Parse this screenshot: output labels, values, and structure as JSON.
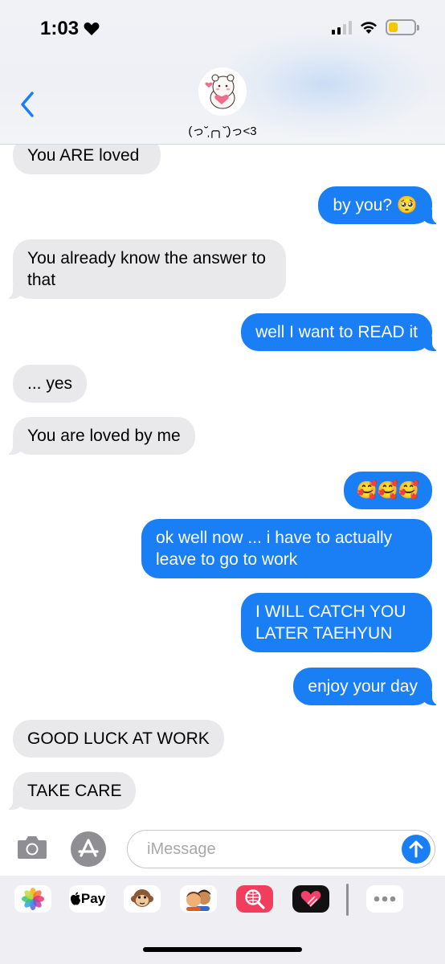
{
  "status_bar": {
    "time": "1:03",
    "battery_level": 0.38,
    "battery_color": "#f7c600"
  },
  "header": {
    "contact_name": "(っ˘̩╭╮˘̩)っ<3",
    "avatar_icon": "bear-holding-heart-icon"
  },
  "messages": [
    {
      "side": "in",
      "text": "You ARE loved"
    },
    {
      "side": "out",
      "text": "by you? 🥺"
    },
    {
      "side": "in",
      "text": "You already know the answer to that"
    },
    {
      "side": "out",
      "text": "well I want to READ it"
    },
    {
      "side": "in",
      "text": "... yes"
    },
    {
      "side": "in",
      "text": "You are loved by me"
    },
    {
      "side": "out",
      "text": "🥰🥰🥰"
    },
    {
      "side": "out",
      "text": "ok well now ... i have to actually leave to go to work"
    },
    {
      "side": "out",
      "text": "I WILL CATCH YOU LATER TAEHYUN"
    },
    {
      "side": "out",
      "text": "enjoy your day"
    },
    {
      "side": "in",
      "text": "GOOD LUCK AT WORK"
    },
    {
      "side": "in",
      "text": "TAKE CARE"
    }
  ],
  "input": {
    "placeholder": "iMessage"
  },
  "drawer": {
    "apps": [
      {
        "name": "photos-icon"
      },
      {
        "name": "apple-pay-icon",
        "label": "Pay"
      },
      {
        "name": "monkey-memoji-icon"
      },
      {
        "name": "memoji-group-icon"
      },
      {
        "name": "web-search-icon"
      },
      {
        "name": "digital-touch-heart-icon"
      },
      {
        "name": "more-apps-icon"
      }
    ]
  },
  "colors": {
    "outgoing_bubble": "#1a7ff5",
    "incoming_bubble": "#e9e9eb",
    "accent": "#1a7ff5"
  }
}
